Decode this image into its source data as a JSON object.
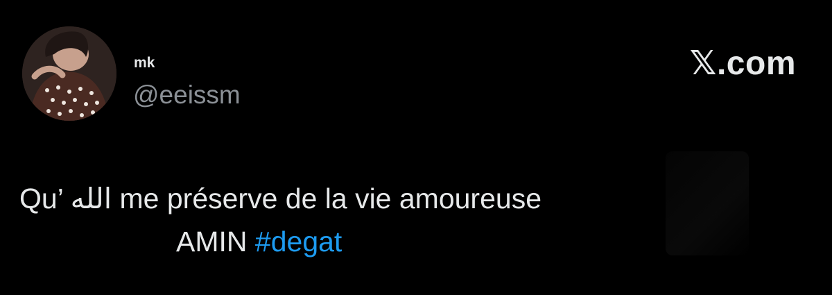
{
  "author": {
    "display_name": "mk",
    "handle": "@eeissm",
    "avatar": "profile-photo"
  },
  "brand": {
    "text": "𝕏.com"
  },
  "tweet": {
    "line1": "Qu’ الله me préserve de la vie amoureuse",
    "line2_text": "AMIN",
    "hashtag": "#degat"
  },
  "colors": {
    "background": "#000000",
    "text": "#e7e9ea",
    "handle": "#8b9096",
    "hashtag": "#1d9bf0"
  }
}
